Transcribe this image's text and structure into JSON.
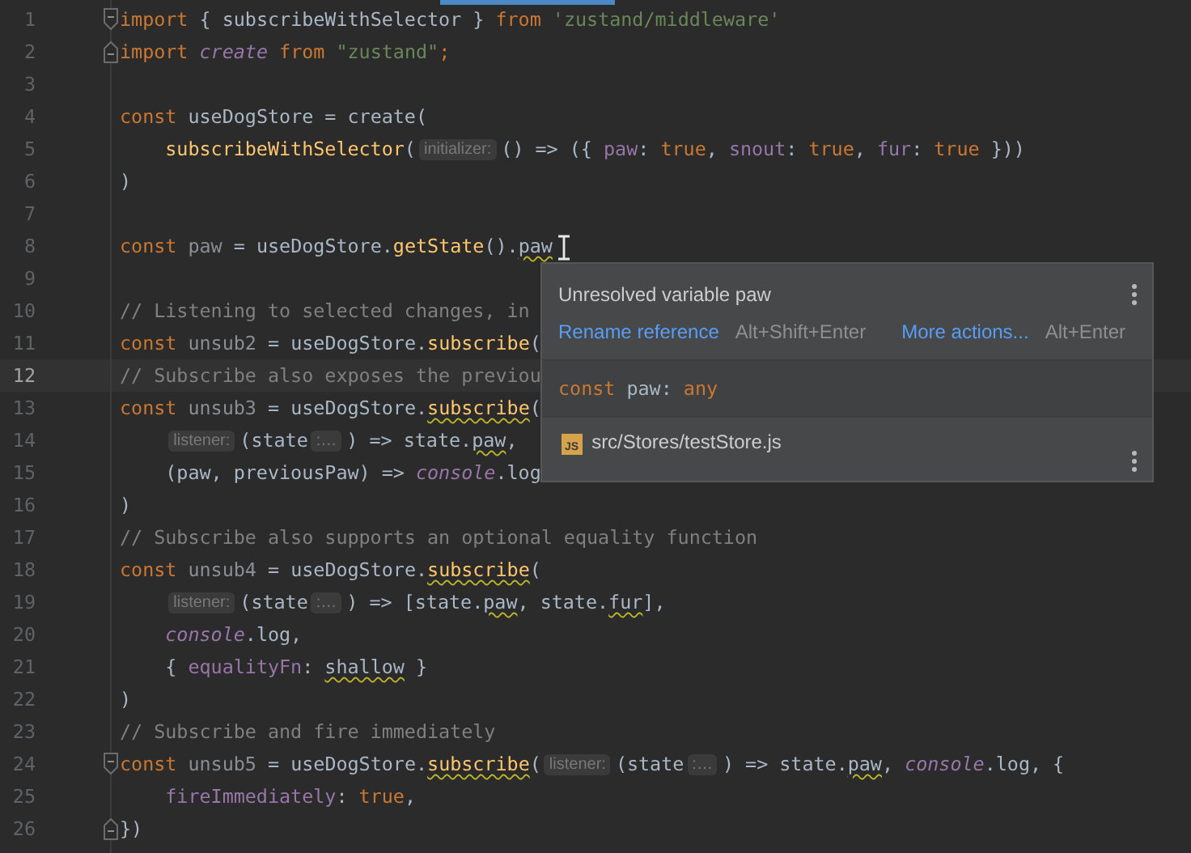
{
  "editor": {
    "lines": [
      {
        "number": "1",
        "current": false,
        "kind": "fold-start",
        "indented": false,
        "tokens": [
          {
            "kind": "kw",
            "text": "import"
          },
          {
            "kind": "txt",
            "text": " { subscribeWithSelector } "
          },
          {
            "kind": "kw",
            "text": "from "
          },
          {
            "kind": "str",
            "text": "'zustand/middleware'"
          }
        ]
      },
      {
        "number": "2",
        "current": false,
        "kind": "fold-end",
        "indented": false,
        "tokens": [
          {
            "kind": "kw",
            "text": "import "
          },
          {
            "kind": "glob",
            "text": "create"
          },
          {
            "kind": "kw",
            "text": " from "
          },
          {
            "kind": "str",
            "text": "\"zustand\""
          },
          {
            "kind": "kw",
            "text": ";"
          }
        ]
      },
      {
        "number": "3",
        "current": false,
        "kind": "plain"
      },
      {
        "number": "4",
        "current": false,
        "kind": "plain",
        "indented": false,
        "tokens": [
          {
            "kind": "kw",
            "text": "const "
          },
          {
            "kind": "txt",
            "text": "useDogStore = create("
          }
        ]
      },
      {
        "number": "5",
        "current": false,
        "kind": "plain",
        "indented": true,
        "tokens": [
          {
            "kind": "fn",
            "text": "subscribeWithSelector"
          },
          {
            "kind": "txt",
            "text": "("
          },
          {
            "kind": "hint",
            "text": "initializer:"
          },
          {
            "kind": "txt",
            "text": "() => ({ "
          },
          {
            "kind": "prop",
            "text": "paw"
          },
          {
            "kind": "txt",
            "text": ": "
          },
          {
            "kind": "kw",
            "text": "true"
          },
          {
            "kind": "txt",
            "text": ", "
          },
          {
            "kind": "prop",
            "text": "snout"
          },
          {
            "kind": "txt",
            "text": ": "
          },
          {
            "kind": "kw",
            "text": "true"
          },
          {
            "kind": "txt",
            "text": ", "
          },
          {
            "kind": "prop",
            "text": "fur"
          },
          {
            "kind": "txt",
            "text": ": "
          },
          {
            "kind": "kw",
            "text": "true"
          },
          {
            "kind": "txt",
            "text": " }))"
          }
        ]
      },
      {
        "number": "6",
        "current": false,
        "kind": "plain",
        "indented": false,
        "tokens": [
          {
            "kind": "txt",
            "text": ")"
          }
        ]
      },
      {
        "number": "7",
        "current": false,
        "kind": "plain"
      },
      {
        "number": "8",
        "current": false,
        "kind": "plain",
        "indented": false,
        "tokens": [
          {
            "kind": "kw",
            "text": "const "
          },
          {
            "kind": "unused",
            "text": "paw"
          },
          {
            "kind": "txt",
            "text": " = useDogStore."
          },
          {
            "kind": "fn",
            "text": "getState"
          },
          {
            "kind": "txt",
            "text": "()."
          },
          {
            "kind": "txt",
            "text": "paw",
            "warn": true
          }
        ]
      },
      {
        "number": "9",
        "current": false,
        "kind": "plain"
      },
      {
        "number": "10",
        "current": false,
        "kind": "plain",
        "indented": false,
        "tokens": [
          {
            "kind": "comment",
            "text": "// Listening to selected changes, in"
          }
        ]
      },
      {
        "number": "11",
        "current": false,
        "kind": "plain",
        "indented": false,
        "tokens": [
          {
            "kind": "kw",
            "text": "const "
          },
          {
            "kind": "unused",
            "text": "unsub2"
          },
          {
            "kind": "txt",
            "text": " = useDogStore."
          },
          {
            "kind": "fn",
            "text": "subscribe"
          },
          {
            "kind": "txt",
            "text": "("
          }
        ]
      },
      {
        "number": "12",
        "current": true,
        "kind": "plain",
        "indented": false,
        "tokens": [
          {
            "kind": "comment",
            "text": "// Subscribe also exposes the previou"
          }
        ]
      },
      {
        "number": "13",
        "current": false,
        "kind": "plain",
        "indented": false,
        "tokens": [
          {
            "kind": "kw",
            "text": "const "
          },
          {
            "kind": "unused",
            "text": "unsub3"
          },
          {
            "kind": "txt",
            "text": " = useDogStore."
          },
          {
            "kind": "fn",
            "text": "subscribe",
            "warn": true
          },
          {
            "kind": "txt",
            "text": "("
          }
        ]
      },
      {
        "number": "14",
        "current": false,
        "kind": "plain",
        "indented": true,
        "tokens": [
          {
            "kind": "hint",
            "text": "listener:"
          },
          {
            "kind": "txt",
            "text": "(state"
          },
          {
            "kind": "hint",
            "text": ":…"
          },
          {
            "kind": "txt",
            "text": ") => state."
          },
          {
            "kind": "txt",
            "text": "paw",
            "warn": true
          },
          {
            "kind": "txt",
            "text": ","
          }
        ]
      },
      {
        "number": "15",
        "current": false,
        "kind": "plain",
        "indented": true,
        "tokens": [
          {
            "kind": "txt",
            "text": "(paw, previousPaw) => "
          },
          {
            "kind": "glob",
            "text": "console"
          },
          {
            "kind": "txt",
            "text": ".log"
          }
        ]
      },
      {
        "number": "16",
        "current": false,
        "kind": "plain",
        "indented": false,
        "tokens": [
          {
            "kind": "txt",
            "text": ")"
          }
        ]
      },
      {
        "number": "17",
        "current": false,
        "kind": "plain",
        "indented": false,
        "tokens": [
          {
            "kind": "comment",
            "text": "// Subscribe also supports an optional equality function"
          }
        ]
      },
      {
        "number": "18",
        "current": false,
        "kind": "plain",
        "indented": false,
        "tokens": [
          {
            "kind": "kw",
            "text": "const "
          },
          {
            "kind": "unused",
            "text": "unsub4"
          },
          {
            "kind": "txt",
            "text": " = useDogStore."
          },
          {
            "kind": "fn",
            "text": "subscribe",
            "warn": true
          },
          {
            "kind": "txt",
            "text": "("
          }
        ]
      },
      {
        "number": "19",
        "current": false,
        "kind": "plain",
        "indented": true,
        "tokens": [
          {
            "kind": "hint",
            "text": "listener:"
          },
          {
            "kind": "txt",
            "text": "(state"
          },
          {
            "kind": "hint",
            "text": ":…"
          },
          {
            "kind": "txt",
            "text": ") => [state."
          },
          {
            "kind": "txt",
            "text": "paw",
            "warn": true
          },
          {
            "kind": "txt",
            "text": ", state."
          },
          {
            "kind": "txt",
            "text": "fur",
            "warn": true
          },
          {
            "kind": "txt",
            "text": "],"
          }
        ]
      },
      {
        "number": "20",
        "current": false,
        "kind": "plain",
        "indented": true,
        "tokens": [
          {
            "kind": "glob",
            "text": "console"
          },
          {
            "kind": "txt",
            "text": ".log,"
          }
        ]
      },
      {
        "number": "21",
        "current": false,
        "kind": "plain",
        "indented": true,
        "tokens": [
          {
            "kind": "txt",
            "text": "{ "
          },
          {
            "kind": "prop",
            "text": "equalityFn"
          },
          {
            "kind": "txt",
            "text": ": "
          },
          {
            "kind": "txt",
            "text": "shallow",
            "warn": true
          },
          {
            "kind": "txt",
            "text": " }"
          }
        ]
      },
      {
        "number": "22",
        "current": false,
        "kind": "plain",
        "indented": false,
        "tokens": [
          {
            "kind": "txt",
            "text": ")"
          }
        ]
      },
      {
        "number": "23",
        "current": false,
        "kind": "plain",
        "indented": false,
        "tokens": [
          {
            "kind": "comment",
            "text": "// Subscribe and fire immediately"
          }
        ]
      },
      {
        "number": "24",
        "current": false,
        "kind": "fold-start",
        "indented": false,
        "tokens": [
          {
            "kind": "kw",
            "text": "const "
          },
          {
            "kind": "unused",
            "text": "unsub5"
          },
          {
            "kind": "txt",
            "text": " = useDogStore."
          },
          {
            "kind": "fn",
            "text": "subscribe",
            "warn": true
          },
          {
            "kind": "txt",
            "text": "("
          },
          {
            "kind": "hint",
            "text": "listener:"
          },
          {
            "kind": "txt",
            "text": "(state"
          },
          {
            "kind": "hint",
            "text": ":…"
          },
          {
            "kind": "txt",
            "text": ") => state."
          },
          {
            "kind": "txt",
            "text": "paw",
            "warn": true
          },
          {
            "kind": "txt",
            "text": ", "
          },
          {
            "kind": "glob",
            "text": "console"
          },
          {
            "kind": "txt",
            "text": ".log, {"
          }
        ]
      },
      {
        "number": "25",
        "current": false,
        "kind": "plain",
        "indented": true,
        "tokens": [
          {
            "kind": "prop",
            "text": "fireImmediately"
          },
          {
            "kind": "txt",
            "text": ": "
          },
          {
            "kind": "kw",
            "text": "true"
          },
          {
            "kind": "txt",
            "text": ","
          }
        ]
      },
      {
        "number": "26",
        "current": false,
        "kind": "fold-end",
        "indented": false,
        "tokens": [
          {
            "kind": "txt",
            "text": "})"
          }
        ]
      }
    ]
  },
  "popup": {
    "title": "Unresolved variable paw",
    "actions": [
      {
        "label": "Rename reference",
        "shortcut": "Alt+Shift+Enter"
      },
      {
        "label": "More actions...",
        "shortcut": "Alt+Enter"
      }
    ],
    "signature": [
      {
        "kind": "kw",
        "text": "const "
      },
      {
        "kind": "txt",
        "text": "paw: "
      },
      {
        "kind": "kw",
        "text": "any"
      }
    ],
    "file": "src/Stores/testStore.js",
    "file_badge": "JS"
  }
}
